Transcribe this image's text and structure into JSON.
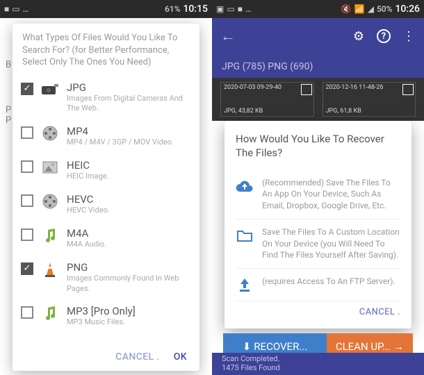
{
  "phone1": {
    "status": {
      "battery": "61%",
      "time": "10:15"
    },
    "bg": {
      "b": "B",
      "p": "P",
      "pt": "P"
    },
    "dialog": {
      "title": "What Types Of Files Would You Like To Search For? (for Better Performance, Select Only The Ones You Need)",
      "cancel": "CANCEL .",
      "ok": "OK"
    },
    "files": [
      {
        "name": "JPG",
        "desc": "Images From Digital Cameras And The Web.",
        "checked": true,
        "icon": "camera"
      },
      {
        "name": "MP4",
        "desc": "MP4 / M4V / 3GP / MOV Video.",
        "checked": false,
        "icon": "reel"
      },
      {
        "name": "HEIC",
        "desc": "HEIC Image.",
        "checked": false,
        "icon": "photo"
      },
      {
        "name": "HEVC",
        "desc": "HEVC Video.",
        "checked": false,
        "icon": "reel"
      },
      {
        "name": "M4A",
        "desc": "M4A Audio.",
        "checked": false,
        "icon": "note"
      },
      {
        "name": "PNG",
        "desc": "Images Commonly Found In Web Pages.",
        "checked": true,
        "icon": "cone"
      },
      {
        "name": "MP3   [Pro Only]",
        "desc": "MP3 Music Files.",
        "checked": false,
        "icon": "note"
      }
    ]
  },
  "phone2": {
    "status": {
      "battery": "50%",
      "time": "10:26"
    },
    "tabs": "JPG (785) PNG (690)",
    "thumbs": [
      {
        "label": "2020-07-03 09-29-40",
        "size": "JPG, 43,82 KB"
      },
      {
        "label": "2020-12-16 11-48-26",
        "size": "JPG, 61,8 KB"
      }
    ],
    "dialog": {
      "title": "How Would You Like To Recover The Files?",
      "opt1": "(Recommended) Save The Files To An App On Your Device, Such As Email, Dropbox, Google Drive, Etc.",
      "opt2": "Save The Files To A Custom Location On Your Device (you Will Need To Find The Files Yourself After Saving).",
      "opt3": "(requires Access To An FTP Server).",
      "cancel": "CANCEL ."
    },
    "recover": "RECOVER...",
    "cleanup": "CLEAN UP...",
    "footer1": "Scan Completed.",
    "footer2": "1475 Files Found"
  }
}
